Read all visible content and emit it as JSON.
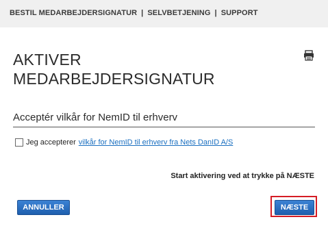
{
  "topnav": {
    "items": [
      "BESTIL MEDARBEJDERSIGNATUR",
      "SELVBETJENING",
      "SUPPORT"
    ],
    "separator": "|"
  },
  "page": {
    "title": "AKTIVER MEDARBEJDERSIGNATUR",
    "print_icon": "print-icon",
    "subheading": "Acceptér vilkår for NemID til erhverv"
  },
  "terms": {
    "checkbox_label": "Jeg accepterer",
    "link_text": "vilkår for NemID til erhverv fra Nets DanID A/S",
    "checked": false
  },
  "instruction": "Start aktivering ved at trykke på NÆSTE",
  "buttons": {
    "cancel_label": "ANNULLER",
    "next_label": "NÆSTE"
  },
  "colors": {
    "button_blue": "#1e5fae",
    "link_blue": "#1a6fc0",
    "highlight_red": "#d41c24"
  }
}
